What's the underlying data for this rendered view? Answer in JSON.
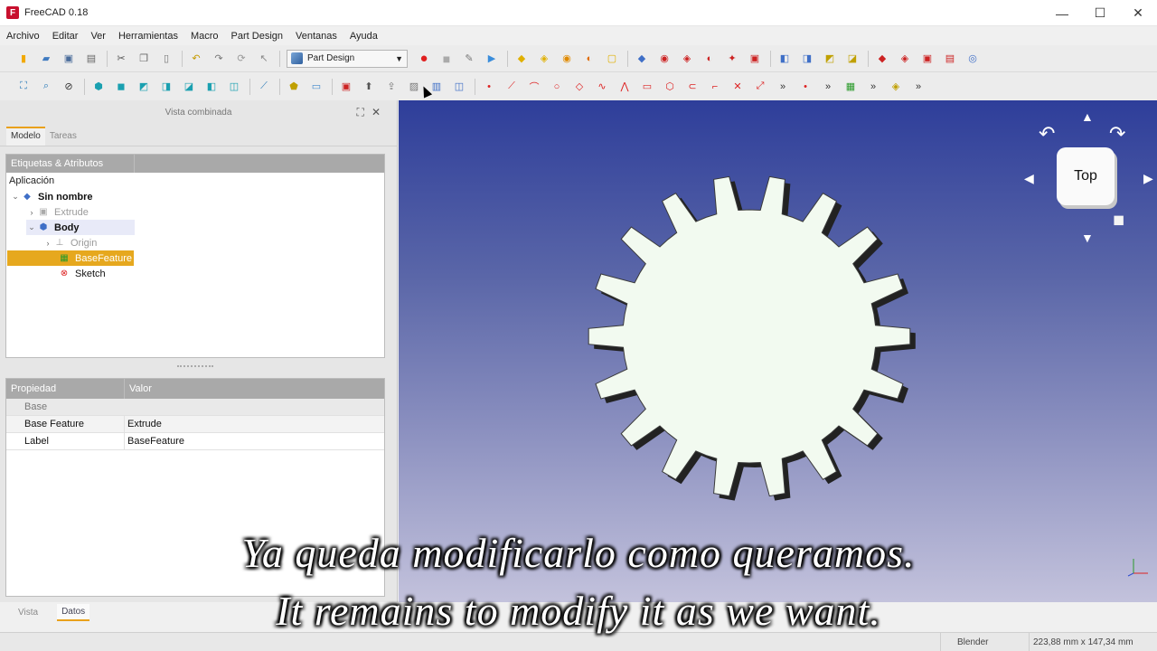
{
  "window": {
    "title": "FreeCAD 0.18",
    "minimize": "—",
    "maximize": "☐",
    "close": "✕"
  },
  "menu": [
    "Archivo",
    "Editar",
    "Ver",
    "Herramientas",
    "Macro",
    "Part Design",
    "Ventanas",
    "Ayuda"
  ],
  "toolbar": {
    "workbench": "Part Design"
  },
  "combo_view": {
    "title": "Vista combinada",
    "tabs": [
      "Modelo",
      "Tareas"
    ],
    "tree_header": "Etiquetas & Atributos",
    "tree_section": "Aplicación",
    "tree": [
      {
        "label": "Sin nombre"
      },
      {
        "label": "Extrude"
      },
      {
        "label": "Body"
      },
      {
        "label": "Origin"
      },
      {
        "label": "BaseFeature"
      },
      {
        "label": "Sketch"
      }
    ],
    "props_header": {
      "property": "Propiedad",
      "value": "Valor"
    },
    "props_group": "Base",
    "props": [
      {
        "name": "Base Feature",
        "value": "Extrude"
      },
      {
        "name": "Label",
        "value": "BaseFeature"
      }
    ],
    "bottom_tabs": [
      "Vista",
      "Datos"
    ]
  },
  "view3d": {
    "navcube_face": "Top"
  },
  "status": {
    "navigation": "Blender",
    "dimensions": "223,88 mm x 147,34 mm"
  },
  "subtitles": {
    "es": "Ya queda modificarlo como queramos.",
    "en": "It remains to modify it as we want."
  },
  "colors": {
    "accent": "#e9a11b",
    "selection": "#e6a81e",
    "view_top": "#2e3e9a",
    "view_bottom": "#c3c2dc"
  }
}
